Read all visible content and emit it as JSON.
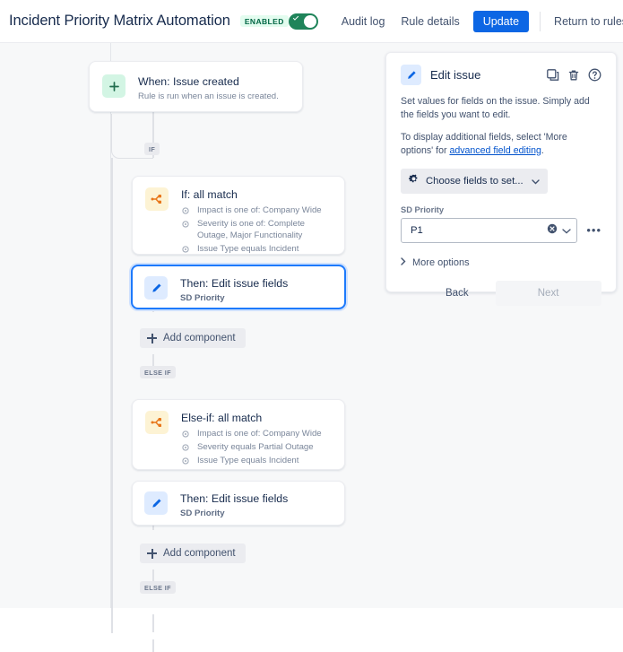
{
  "header": {
    "rule_title": "Incident Priority Matrix Automation",
    "status_badge": "ENABLED",
    "toggle_on": true,
    "audit_log": "Audit log",
    "rule_details": "Rule details",
    "update": "Update",
    "return_to_rules": "Return to rules",
    "accent_color": "#0c66e4",
    "toggle_color": "#1f845a",
    "badge_bg": "#e3fcef",
    "badge_color": "#006644"
  },
  "flow": {
    "trigger": {
      "title": "When: Issue created",
      "subtitle": "Rule is run when an issue is created."
    },
    "branches": [
      {
        "pill": "IF",
        "condition": {
          "title": "If: all match",
          "rows": [
            "Impact is one of: Company Wide",
            "Severity is one of: Complete Outage, Major Functionality",
            "Issue Type equals Incident"
          ]
        },
        "action": {
          "title": "Then: Edit issue fields",
          "subtitle": "SD Priority",
          "selected": true
        },
        "add_component": "Add component"
      },
      {
        "pill": "ELSE IF",
        "condition": {
          "title": "Else-if: all match",
          "rows": [
            "Impact is one of: Company Wide",
            "Severity equals Partial Outage",
            "Issue Type equals Incident"
          ]
        },
        "action": {
          "title": "Then: Edit issue fields",
          "subtitle": "SD Priority",
          "selected": false
        },
        "add_component": "Add component"
      }
    ],
    "trailing_pill": "ELSE IF"
  },
  "panel": {
    "title": "Edit issue",
    "description_1": "Set values for fields on the issue. Simply add the fields you want to edit.",
    "description_2_pre": "To display additional fields, select 'More options' for ",
    "description_2_link": "advanced field editing",
    "description_2_post": ".",
    "choose_fields_label": "Choose fields to set...",
    "field_label": "SD Priority",
    "field_value": "P1",
    "more_options": "More options",
    "back": "Back",
    "next": "Next"
  }
}
